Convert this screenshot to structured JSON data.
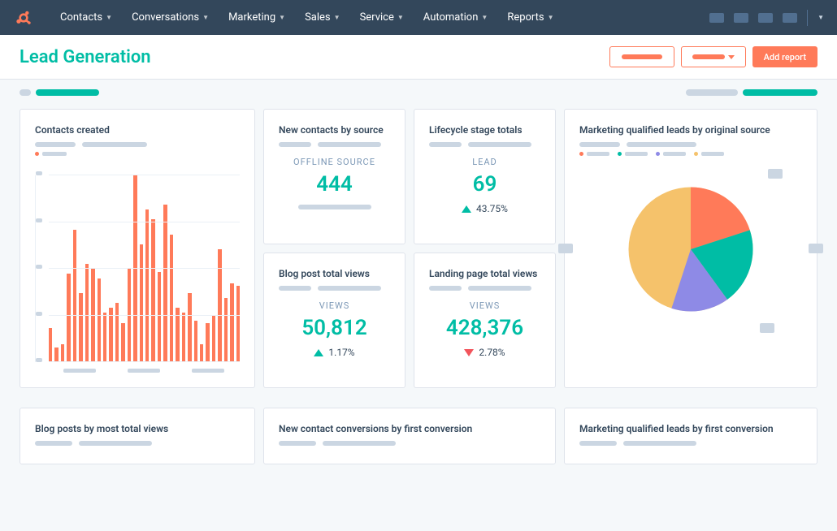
{
  "nav": {
    "items": [
      "Contacts",
      "Conversations",
      "Marketing",
      "Sales",
      "Service",
      "Automation",
      "Reports"
    ]
  },
  "header": {
    "title": "Lead Generation",
    "add_report": "Add report"
  },
  "cards": {
    "contacts_created": {
      "title": "Contacts created"
    },
    "new_contacts": {
      "title": "New contacts by source",
      "label": "OFFLINE SOURCE",
      "value": "444"
    },
    "lifecycle": {
      "title": "Lifecycle stage totals",
      "label": "LEAD",
      "value": "69",
      "change": "43.75%"
    },
    "blog_views": {
      "title": "Blog post total views",
      "label": "VIEWS",
      "value": "50,812",
      "change": "1.17%"
    },
    "landing_views": {
      "title": "Landing page total views",
      "label": "VIEWS",
      "value": "428,376",
      "change": "2.78%"
    },
    "mql_source": {
      "title": "Marketing qualified leads by original source"
    },
    "blog_posts": {
      "title": "Blog posts by most total views"
    },
    "conversions": {
      "title": "New contact conversions by first conversion"
    },
    "mql_conv": {
      "title": "Marketing qualified leads by first conversion"
    }
  },
  "chart_data": [
    {
      "type": "bar",
      "title": "Contacts created",
      "values": [
        35,
        15,
        18,
        90,
        135,
        70,
        100,
        95,
        85,
        50,
        55,
        60,
        40,
        95,
        190,
        120,
        155,
        145,
        92,
        160,
        130,
        55,
        50,
        70,
        42,
        18,
        40,
        48,
        115,
        65,
        80,
        78
      ]
    },
    {
      "type": "pie",
      "title": "Marketing qualified leads by original source",
      "series": [
        {
          "name": "segment-1",
          "value": 50,
          "color": "#f5c26b"
        },
        {
          "name": "segment-2",
          "value": 15,
          "color": "#ff7a59"
        },
        {
          "name": "segment-3",
          "value": 18,
          "color": "#00bda5"
        },
        {
          "name": "segment-4",
          "value": 17,
          "color": "#8e8ae6"
        }
      ]
    }
  ]
}
